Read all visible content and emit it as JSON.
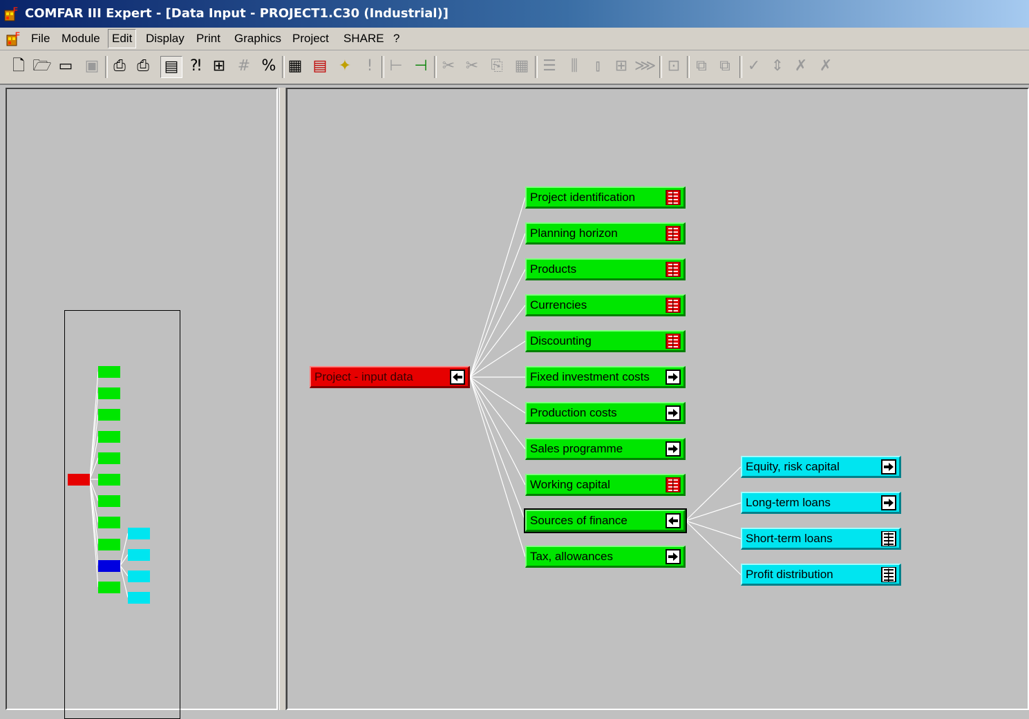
{
  "window": {
    "title": "COMFAR III Expert - [Data Input - PROJECT1.C30 (Industrial)]"
  },
  "menu": [
    "File",
    "Module",
    "Edit",
    "Display",
    "Print",
    "Graphics",
    "Project",
    "SHARE",
    "?"
  ],
  "menu_active": "Edit",
  "toolbar": [
    "new-icon",
    "open-icon",
    "open-folder-icon",
    "save-icon",
    "print-icon",
    "print-preview-icon",
    "table-view-icon",
    "query-number-icon",
    "number-format-icon",
    "grid-hash-icon",
    "percent-hash-icon",
    "spreadsheet-icon",
    "calculator-icon",
    "wizard-folder-icon",
    "exclamation-icon",
    "expand-tree-icon",
    "collapse-tree-icon",
    "cut-icon",
    "cut-all-icon",
    "copy-icon",
    "paste-icon",
    "rows-icon",
    "columns-icon",
    "insert-column-icon",
    "insert-block-icon",
    "chart-icon",
    "link-icon",
    "move-left-icon",
    "move-right-icon",
    "check-icon",
    "up-down-icon",
    "clear-icon",
    "clear-all-icon"
  ],
  "tree": {
    "root": {
      "label": "Project - input data",
      "icon": "arrow-left-icon",
      "color": "#e60000"
    },
    "children": [
      {
        "label": "Project identification",
        "icon": "red-table-icon"
      },
      {
        "label": "Planning horizon",
        "icon": "red-table-icon"
      },
      {
        "label": "Products",
        "icon": "red-table-icon"
      },
      {
        "label": "Currencies",
        "icon": "red-table-icon"
      },
      {
        "label": "Discounting",
        "icon": "red-table-icon"
      },
      {
        "label": "Fixed investment costs",
        "icon": "arrow-right-icon"
      },
      {
        "label": "Production costs",
        "icon": "arrow-right-icon"
      },
      {
        "label": "Sales programme",
        "icon": "arrow-right-icon"
      },
      {
        "label": "Working capital",
        "icon": "red-table-icon"
      },
      {
        "label": "Sources of finance",
        "icon": "arrow-left-icon",
        "selected": true
      },
      {
        "label": "Tax, allowances",
        "icon": "arrow-right-icon"
      }
    ],
    "finance_children": [
      {
        "label": "Equity, risk capital",
        "icon": "arrow-right-icon"
      },
      {
        "label": "Long-term loans",
        "icon": "arrow-right-icon"
      },
      {
        "label": "Short-term loans",
        "icon": "white-table-icon"
      },
      {
        "label": "Profit distribution",
        "icon": "white-table-icon"
      }
    ]
  },
  "colors": {
    "green": "#00e600",
    "red": "#e60000",
    "cyan": "#00e5f0",
    "selected_mini": "#0000e0"
  }
}
